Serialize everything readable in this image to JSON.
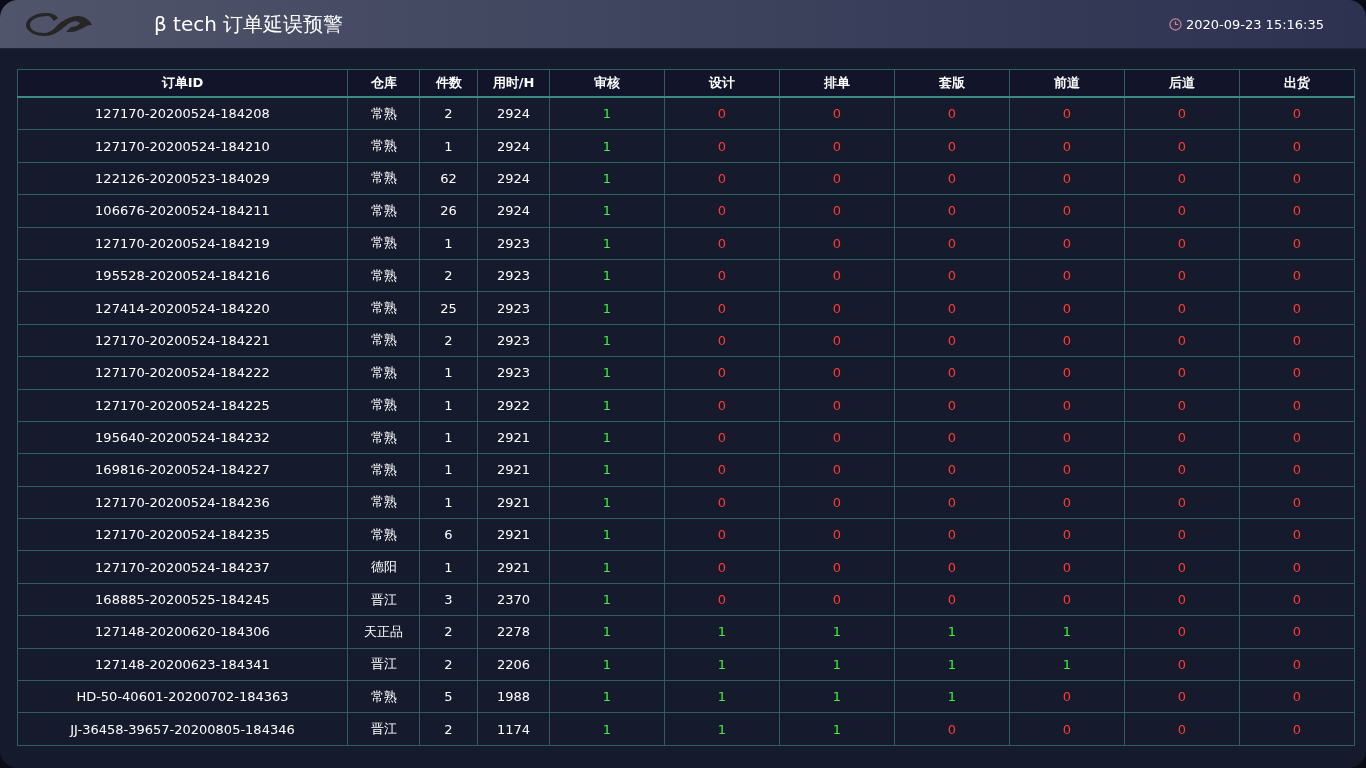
{
  "header": {
    "title": "β tech 订单延误预警",
    "datetime": "2020-09-23 15:16:35"
  },
  "table": {
    "columns": [
      "订单ID",
      "仓库",
      "件数",
      "用时/H",
      "审核",
      "设计",
      "排单",
      "套版",
      "前道",
      "后道",
      "出货"
    ],
    "rows": [
      {
        "id": "127170-20200524-184208",
        "warehouse": "常熟",
        "count": "2",
        "hours": "2924",
        "stages": [
          {
            "value": "1",
            "done": true
          },
          {
            "value": "0",
            "done": false
          },
          {
            "value": "0",
            "done": false
          },
          {
            "value": "0",
            "done": false
          },
          {
            "value": "0",
            "done": false
          },
          {
            "value": "0",
            "done": false
          },
          {
            "value": "0",
            "done": false
          }
        ]
      },
      {
        "id": "127170-20200524-184210",
        "warehouse": "常熟",
        "count": "1",
        "hours": "2924",
        "stages": [
          {
            "value": "1",
            "done": true
          },
          {
            "value": "0",
            "done": false
          },
          {
            "value": "0",
            "done": false
          },
          {
            "value": "0",
            "done": false
          },
          {
            "value": "0",
            "done": false
          },
          {
            "value": "0",
            "done": false
          },
          {
            "value": "0",
            "done": false
          }
        ]
      },
      {
        "id": "122126-20200523-184029",
        "warehouse": "常熟",
        "count": "62",
        "hours": "2924",
        "stages": [
          {
            "value": "1",
            "done": true
          },
          {
            "value": "0",
            "done": false
          },
          {
            "value": "0",
            "done": false
          },
          {
            "value": "0",
            "done": false
          },
          {
            "value": "0",
            "done": false
          },
          {
            "value": "0",
            "done": false
          },
          {
            "value": "0",
            "done": false
          }
        ]
      },
      {
        "id": "106676-20200524-184211",
        "warehouse": "常熟",
        "count": "26",
        "hours": "2924",
        "stages": [
          {
            "value": "1",
            "done": true
          },
          {
            "value": "0",
            "done": false
          },
          {
            "value": "0",
            "done": false
          },
          {
            "value": "0",
            "done": false
          },
          {
            "value": "0",
            "done": false
          },
          {
            "value": "0",
            "done": false
          },
          {
            "value": "0",
            "done": false
          }
        ]
      },
      {
        "id": "127170-20200524-184219",
        "warehouse": "常熟",
        "count": "1",
        "hours": "2923",
        "stages": [
          {
            "value": "1",
            "done": true
          },
          {
            "value": "0",
            "done": false
          },
          {
            "value": "0",
            "done": false
          },
          {
            "value": "0",
            "done": false
          },
          {
            "value": "0",
            "done": false
          },
          {
            "value": "0",
            "done": false
          },
          {
            "value": "0",
            "done": false
          }
        ]
      },
      {
        "id": "195528-20200524-184216",
        "warehouse": "常熟",
        "count": "2",
        "hours": "2923",
        "stages": [
          {
            "value": "1",
            "done": true
          },
          {
            "value": "0",
            "done": false
          },
          {
            "value": "0",
            "done": false
          },
          {
            "value": "0",
            "done": false
          },
          {
            "value": "0",
            "done": false
          },
          {
            "value": "0",
            "done": false
          },
          {
            "value": "0",
            "done": false
          }
        ]
      },
      {
        "id": "127414-20200524-184220",
        "warehouse": "常熟",
        "count": "25",
        "hours": "2923",
        "stages": [
          {
            "value": "1",
            "done": true
          },
          {
            "value": "0",
            "done": false
          },
          {
            "value": "0",
            "done": false
          },
          {
            "value": "0",
            "done": false
          },
          {
            "value": "0",
            "done": false
          },
          {
            "value": "0",
            "done": false
          },
          {
            "value": "0",
            "done": false
          }
        ]
      },
      {
        "id": "127170-20200524-184221",
        "warehouse": "常熟",
        "count": "2",
        "hours": "2923",
        "stages": [
          {
            "value": "1",
            "done": true
          },
          {
            "value": "0",
            "done": false
          },
          {
            "value": "0",
            "done": false
          },
          {
            "value": "0",
            "done": false
          },
          {
            "value": "0",
            "done": false
          },
          {
            "value": "0",
            "done": false
          },
          {
            "value": "0",
            "done": false
          }
        ]
      },
      {
        "id": "127170-20200524-184222",
        "warehouse": "常熟",
        "count": "1",
        "hours": "2923",
        "stages": [
          {
            "value": "1",
            "done": true
          },
          {
            "value": "0",
            "done": false
          },
          {
            "value": "0",
            "done": false
          },
          {
            "value": "0",
            "done": false
          },
          {
            "value": "0",
            "done": false
          },
          {
            "value": "0",
            "done": false
          },
          {
            "value": "0",
            "done": false
          }
        ]
      },
      {
        "id": "127170-20200524-184225",
        "warehouse": "常熟",
        "count": "1",
        "hours": "2922",
        "stages": [
          {
            "value": "1",
            "done": true
          },
          {
            "value": "0",
            "done": false
          },
          {
            "value": "0",
            "done": false
          },
          {
            "value": "0",
            "done": false
          },
          {
            "value": "0",
            "done": false
          },
          {
            "value": "0",
            "done": false
          },
          {
            "value": "0",
            "done": false
          }
        ]
      },
      {
        "id": "195640-20200524-184232",
        "warehouse": "常熟",
        "count": "1",
        "hours": "2921",
        "stages": [
          {
            "value": "1",
            "done": true
          },
          {
            "value": "0",
            "done": false
          },
          {
            "value": "0",
            "done": false
          },
          {
            "value": "0",
            "done": false
          },
          {
            "value": "0",
            "done": false
          },
          {
            "value": "0",
            "done": false
          },
          {
            "value": "0",
            "done": false
          }
        ]
      },
      {
        "id": "169816-20200524-184227",
        "warehouse": "常熟",
        "count": "1",
        "hours": "2921",
        "stages": [
          {
            "value": "1",
            "done": true
          },
          {
            "value": "0",
            "done": false
          },
          {
            "value": "0",
            "done": false
          },
          {
            "value": "0",
            "done": false
          },
          {
            "value": "0",
            "done": false
          },
          {
            "value": "0",
            "done": false
          },
          {
            "value": "0",
            "done": false
          }
        ]
      },
      {
        "id": "127170-20200524-184236",
        "warehouse": "常熟",
        "count": "1",
        "hours": "2921",
        "stages": [
          {
            "value": "1",
            "done": true
          },
          {
            "value": "0",
            "done": false
          },
          {
            "value": "0",
            "done": false
          },
          {
            "value": "0",
            "done": false
          },
          {
            "value": "0",
            "done": false
          },
          {
            "value": "0",
            "done": false
          },
          {
            "value": "0",
            "done": false
          }
        ]
      },
      {
        "id": "127170-20200524-184235",
        "warehouse": "常熟",
        "count": "6",
        "hours": "2921",
        "stages": [
          {
            "value": "1",
            "done": true
          },
          {
            "value": "0",
            "done": false
          },
          {
            "value": "0",
            "done": false
          },
          {
            "value": "0",
            "done": false
          },
          {
            "value": "0",
            "done": false
          },
          {
            "value": "0",
            "done": false
          },
          {
            "value": "0",
            "done": false
          }
        ]
      },
      {
        "id": "127170-20200524-184237",
        "warehouse": "德阳",
        "count": "1",
        "hours": "2921",
        "stages": [
          {
            "value": "1",
            "done": true
          },
          {
            "value": "0",
            "done": false
          },
          {
            "value": "0",
            "done": false
          },
          {
            "value": "0",
            "done": false
          },
          {
            "value": "0",
            "done": false
          },
          {
            "value": "0",
            "done": false
          },
          {
            "value": "0",
            "done": false
          }
        ]
      },
      {
        "id": "168885-20200525-184245",
        "warehouse": "晋江",
        "count": "3",
        "hours": "2370",
        "stages": [
          {
            "value": "1",
            "done": true
          },
          {
            "value": "0",
            "done": false
          },
          {
            "value": "0",
            "done": false
          },
          {
            "value": "0",
            "done": false
          },
          {
            "value": "0",
            "done": false
          },
          {
            "value": "0",
            "done": false
          },
          {
            "value": "0",
            "done": false
          }
        ]
      },
      {
        "id": "127148-20200620-184306",
        "warehouse": "天正品",
        "count": "2",
        "hours": "2278",
        "stages": [
          {
            "value": "1",
            "done": true
          },
          {
            "value": "1",
            "done": true
          },
          {
            "value": "1",
            "done": true
          },
          {
            "value": "1",
            "done": true
          },
          {
            "value": "1",
            "done": true
          },
          {
            "value": "0",
            "done": false
          },
          {
            "value": "0",
            "done": false
          }
        ]
      },
      {
        "id": "127148-20200623-184341",
        "warehouse": "晋江",
        "count": "2",
        "hours": "2206",
        "stages": [
          {
            "value": "1",
            "done": true
          },
          {
            "value": "1",
            "done": true
          },
          {
            "value": "1",
            "done": true
          },
          {
            "value": "1",
            "done": true
          },
          {
            "value": "1",
            "done": true
          },
          {
            "value": "0",
            "done": false
          },
          {
            "value": "0",
            "done": false
          }
        ]
      },
      {
        "id": "HD-50-40601-20200702-184363",
        "warehouse": "常熟",
        "count": "5",
        "hours": "1988",
        "stages": [
          {
            "value": "1",
            "done": true
          },
          {
            "value": "1",
            "done": true
          },
          {
            "value": "1",
            "done": true
          },
          {
            "value": "1",
            "done": true
          },
          {
            "value": "0",
            "done": false
          },
          {
            "value": "0",
            "done": false
          },
          {
            "value": "0",
            "done": false
          }
        ]
      },
      {
        "id": "JJ-36458-39657-20200805-184346",
        "warehouse": "晋江",
        "count": "2",
        "hours": "1174",
        "stages": [
          {
            "value": "1",
            "done": true
          },
          {
            "value": "1",
            "done": true
          },
          {
            "value": "1",
            "done": true
          },
          {
            "value": "0",
            "done": false
          },
          {
            "value": "0",
            "done": false
          },
          {
            "value": "0",
            "done": false
          },
          {
            "value": "0",
            "done": false
          }
        ]
      }
    ]
  }
}
